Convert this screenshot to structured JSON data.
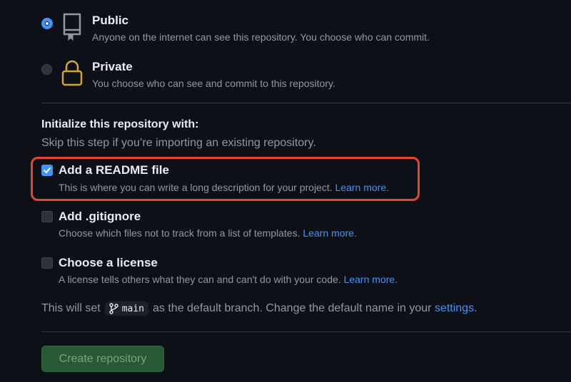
{
  "visibility": {
    "public": {
      "title": "Public",
      "description": "Anyone on the internet can see this repository. You choose who can commit.",
      "selected": true,
      "icon": "repo-icon"
    },
    "private": {
      "title": "Private",
      "description": "You choose who can see and commit to this repository.",
      "selected": false,
      "icon": "lock-icon"
    }
  },
  "initialize": {
    "title": "Initialize this repository with:",
    "subtitle": "Skip this step if you’re importing an existing repository.",
    "options": [
      {
        "title": "Add a README file",
        "description": "This is where you can write a long description for your project.",
        "link": "Learn more.",
        "checked": true
      },
      {
        "title": "Add .gitignore",
        "description": "Choose which files not to track from a list of templates.",
        "link": "Learn more.",
        "checked": false
      },
      {
        "title": "Choose a license",
        "description": "A license tells others what they can and can't do with your code.",
        "link": "Learn more.",
        "checked": false
      }
    ]
  },
  "branch": {
    "prefix": "This will set",
    "name": "main",
    "suffix": "as the default branch. Change the default name in your",
    "settings_link": "settings",
    "end": "."
  },
  "create_button": {
    "label": "Create repository"
  },
  "colors": {
    "background": "#0d1117",
    "accent": "#4493f8",
    "highlight": "#e5452f",
    "button": "#275a34"
  }
}
